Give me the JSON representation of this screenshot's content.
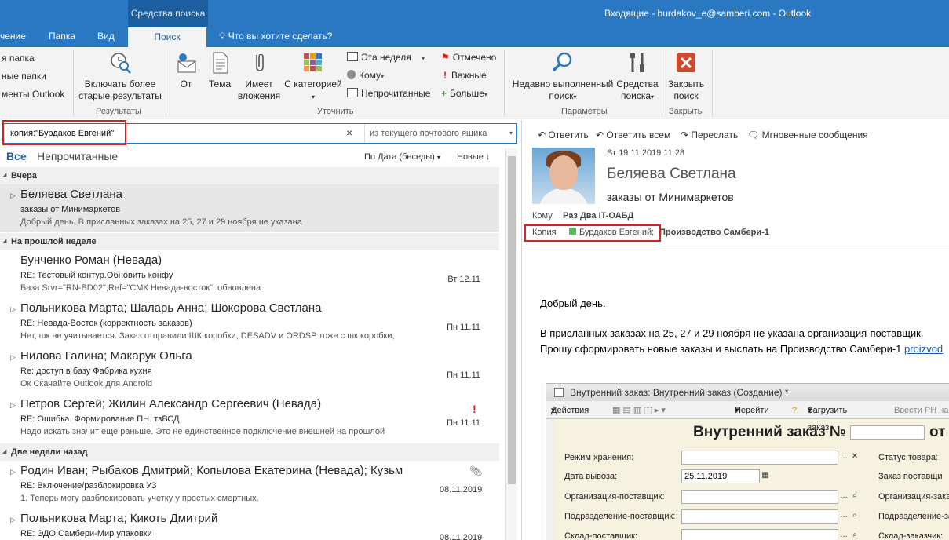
{
  "titlebar": {
    "context_tab": "Средства поиска",
    "window_title": "Входящие - burdakov_e@samberi.com - Outlook"
  },
  "tabs": {
    "t1": "чение",
    "t2": "Папка",
    "t3": "Вид",
    "active": "Поиск",
    "tellme": "Что вы хотите сделать?"
  },
  "ribbon": {
    "scope": {
      "item1": "я папка",
      "item2": "ные папки",
      "item3": "менты Outlook"
    },
    "results": {
      "older_l1": "Включать более",
      "older_l2": "старые результаты",
      "group": "Результаты"
    },
    "refine": {
      "from": "От",
      "subject": "Тема",
      "attach_l1": "Имеет",
      "attach_l2": "вложения",
      "cat_l1": "С категорией",
      "this_week": "Эта неделя",
      "to": "Кому",
      "unread": "Непрочитанные",
      "flagged": "Отмечено",
      "important": "Важные",
      "more": "Больше",
      "group": "Уточнить"
    },
    "options": {
      "recent_l1": "Недавно выполненный",
      "recent_l2": "поиск",
      "tools_l1": "Средства",
      "tools_l2": "поиска",
      "group": "Параметры"
    },
    "close": {
      "l1": "Закрыть",
      "l2": "поиск",
      "group": "Закрыть"
    }
  },
  "search": {
    "query": "копия:\"Бурдаков Евгений\"",
    "scope": "из текущего почтового ящика"
  },
  "filters": {
    "all": "Все",
    "unread": "Непрочитанные",
    "sort": "По Дата (беседы)",
    "order": "Новые"
  },
  "groups": {
    "yesterday": "Вчера",
    "last_week": "На прошлой неделе",
    "two_weeks": "Две недели назад"
  },
  "messages": [
    {
      "from": "Беляева Светлана",
      "subject": "заказы от Минимаркетов",
      "preview": "Добрый день.  В присланных заказах на 25, 27 и 29 ноября не указана",
      "date": ""
    },
    {
      "from": "Бунченко Роман (Невада)",
      "subject": "RE: Тестовый контур.Обновить конфу",
      "preview": "База Srvr=\"RN-BD02\";Ref=\"СМК Невада-восток\"; обновлена",
      "date": "Вт 12.11"
    },
    {
      "from": "Польникова Марта;  Шаларь Анна;  Шокорова Светлана",
      "subject": "RE: Невада-Восток (корректность заказов)",
      "preview": "Нет, шк не учитывается.  Заказ отправили ШК коробки, DESADV  и ORDSP тоже с шк коробки,",
      "date": "Пн 11.11"
    },
    {
      "from": "Нилова Галина;  Макарук Ольга",
      "subject": "Re: доступ в базу Фабрика кухня",
      "preview": "Ок  Скачайте Outlook для Android",
      "date": "Пн 11.11"
    },
    {
      "from": "Петров Сергей;  Жилин Александр Сергеевич (Невада)",
      "subject": "RE: Ошибка. Формирование ПН. тзВСД",
      "preview": "Надо искать значит еще раньше. Это не единственное подключение внешней на прошлой",
      "date": "Пн 11.11",
      "flag": "!"
    },
    {
      "from": "Родин Иван;  Рыбаков Дмитрий;  Копылова Екатерина (Невада);  Кузьм",
      "subject": "RE: Включение/разблокировка УЗ",
      "preview": "1.      Теперь могу разблокировать учетку у простых смертных.",
      "date": "08.11.2019"
    },
    {
      "from": "Польникова Марта;  Кикоть Дмитрий",
      "subject": "RE: ЭДО Самбери-Мир упаковки",
      "preview": "",
      "date": "08.11.2019"
    }
  ],
  "reading": {
    "reply": "Ответить",
    "reply_all": "Ответить всем",
    "forward": "Переслать",
    "im": "Мгновенные сообщения",
    "date": "Вт 19.11.2019 11:28",
    "from": "Беляева Светлана",
    "subject": "заказы от Минимаркетов",
    "to_label": "Кому",
    "to": "Раз Два IT-ОАБД",
    "cc_label": "Копия",
    "cc1": "Бурдаков Евгений;",
    "cc2": "Производство Самбери-1",
    "body_l1": "Добрый день.",
    "body_l2": "В присланных заказах на 25, 27 и 29 ноября не указана организация-поставщик.",
    "body_l3": "Прошу сформировать новые заказы и выслать на Производство Самбери-1 ",
    "body_link": "proizvod"
  },
  "embedded": {
    "title": "Внутренний заказ: Внутренний заказ (Создание) *",
    "actions": "Действия",
    "goto": "Перейти",
    "load": "Загрузить заказ",
    "enter_rn": "Ввести РН на",
    "heading": "Внутренний заказ №",
    "heading_ot": "от",
    "f1": "Режим хранения:",
    "f2": "Дата вывоза:",
    "f2_value": "25.11.2019",
    "f3": "Организация-поставщик:",
    "f4": "Подразделение-поставщик:",
    "f5": "Склад-поставщик:",
    "r1": "Статус товара:",
    "r2": "Заказ поставщи",
    "r3": "Организация-зака",
    "r4": "Подразделение-за",
    "r5": "Склад-заказчик:"
  }
}
